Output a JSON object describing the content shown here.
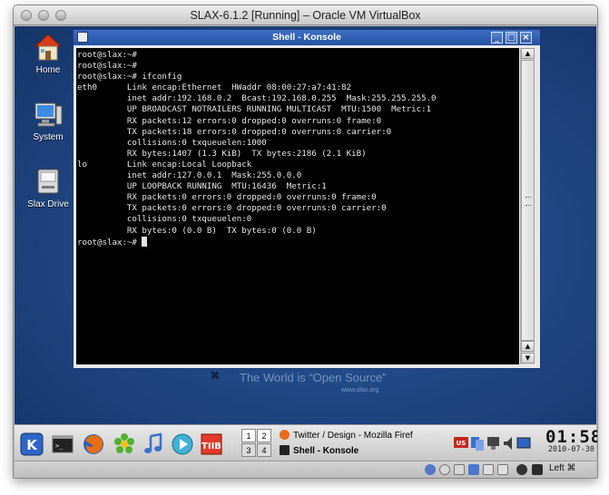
{
  "host_window": {
    "title": "SLAX-6.1.2 [Running] – Oracle VM VirtualBox"
  },
  "desktop": {
    "icons": [
      {
        "label": "Home",
        "icon": "home-icon"
      },
      {
        "label": "System",
        "icon": "computer-icon"
      },
      {
        "label": "Slax Drive",
        "icon": "drive-icon"
      }
    ],
    "wallpaper": {
      "slogan": "The World is “Open Source”",
      "url": "www.slax.org"
    }
  },
  "konsole": {
    "title": "Shell - Konsole",
    "buttons": {
      "minimize": "_",
      "maximize": "□",
      "close": "×"
    },
    "lines": [
      "root@slax:~#",
      "root@slax:~#",
      "root@slax:~# ifconfig",
      "eth0      Link encap:Ethernet  HWaddr 08:00:27:a7:41:82",
      "          inet addr:192.168.0.2  Bcast:192.168.0.255  Mask:255.255.255.0",
      "          UP BROADCAST NOTRAILERS RUNNING MULTICAST  MTU:1500  Metric:1",
      "          RX packets:12 errors:0 dropped:0 overruns:0 frame:0",
      "          TX packets:18 errors:0 dropped:0 overruns:0 carrier:0",
      "          collisions:0 txqueuelen:1000",
      "          RX bytes:1407 (1.3 KiB)  TX bytes:2186 (2.1 KiB)",
      "",
      "lo        Link encap:Local Loopback",
      "          inet addr:127.0.0.1  Mask:255.0.0.0",
      "          UP LOOPBACK RUNNING  MTU:16436  Metric:1",
      "          RX packets:0 errors:0 dropped:0 overruns:0 frame:0",
      "          TX packets:0 errors:0 dropped:0 overruns:0 carrier:0",
      "          collisions:0 txqueuelen:0",
      "          RX bytes:0 (0.0 B)  TX bytes:0 (0.0 B)",
      ""
    ],
    "prompt": "root@slax:~# "
  },
  "taskbar": {
    "launchers": [
      "kde-menu-icon",
      "terminal-icon",
      "firefox-icon",
      "icq-icon",
      "music-icon",
      "media-player-icon",
      "ntb-icon"
    ],
    "pager": [
      "1",
      "2",
      "3",
      "4"
    ],
    "tasks": [
      {
        "label": "Twitter / Design - Mozilla Firef",
        "icon": "firefox-icon"
      },
      {
        "label": "Shell - Konsole",
        "icon": "terminal-icon"
      }
    ],
    "clock": {
      "time": "01:58",
      "date": "2010-07-30"
    }
  },
  "statusbar": {
    "host_key": "Left ⌘"
  },
  "colors": {
    "desktop_blue": "#214985",
    "konsole_title": "#2f5ca8",
    "terminal_bg": "#000000",
    "terminal_fg": "#e6e6e6"
  }
}
